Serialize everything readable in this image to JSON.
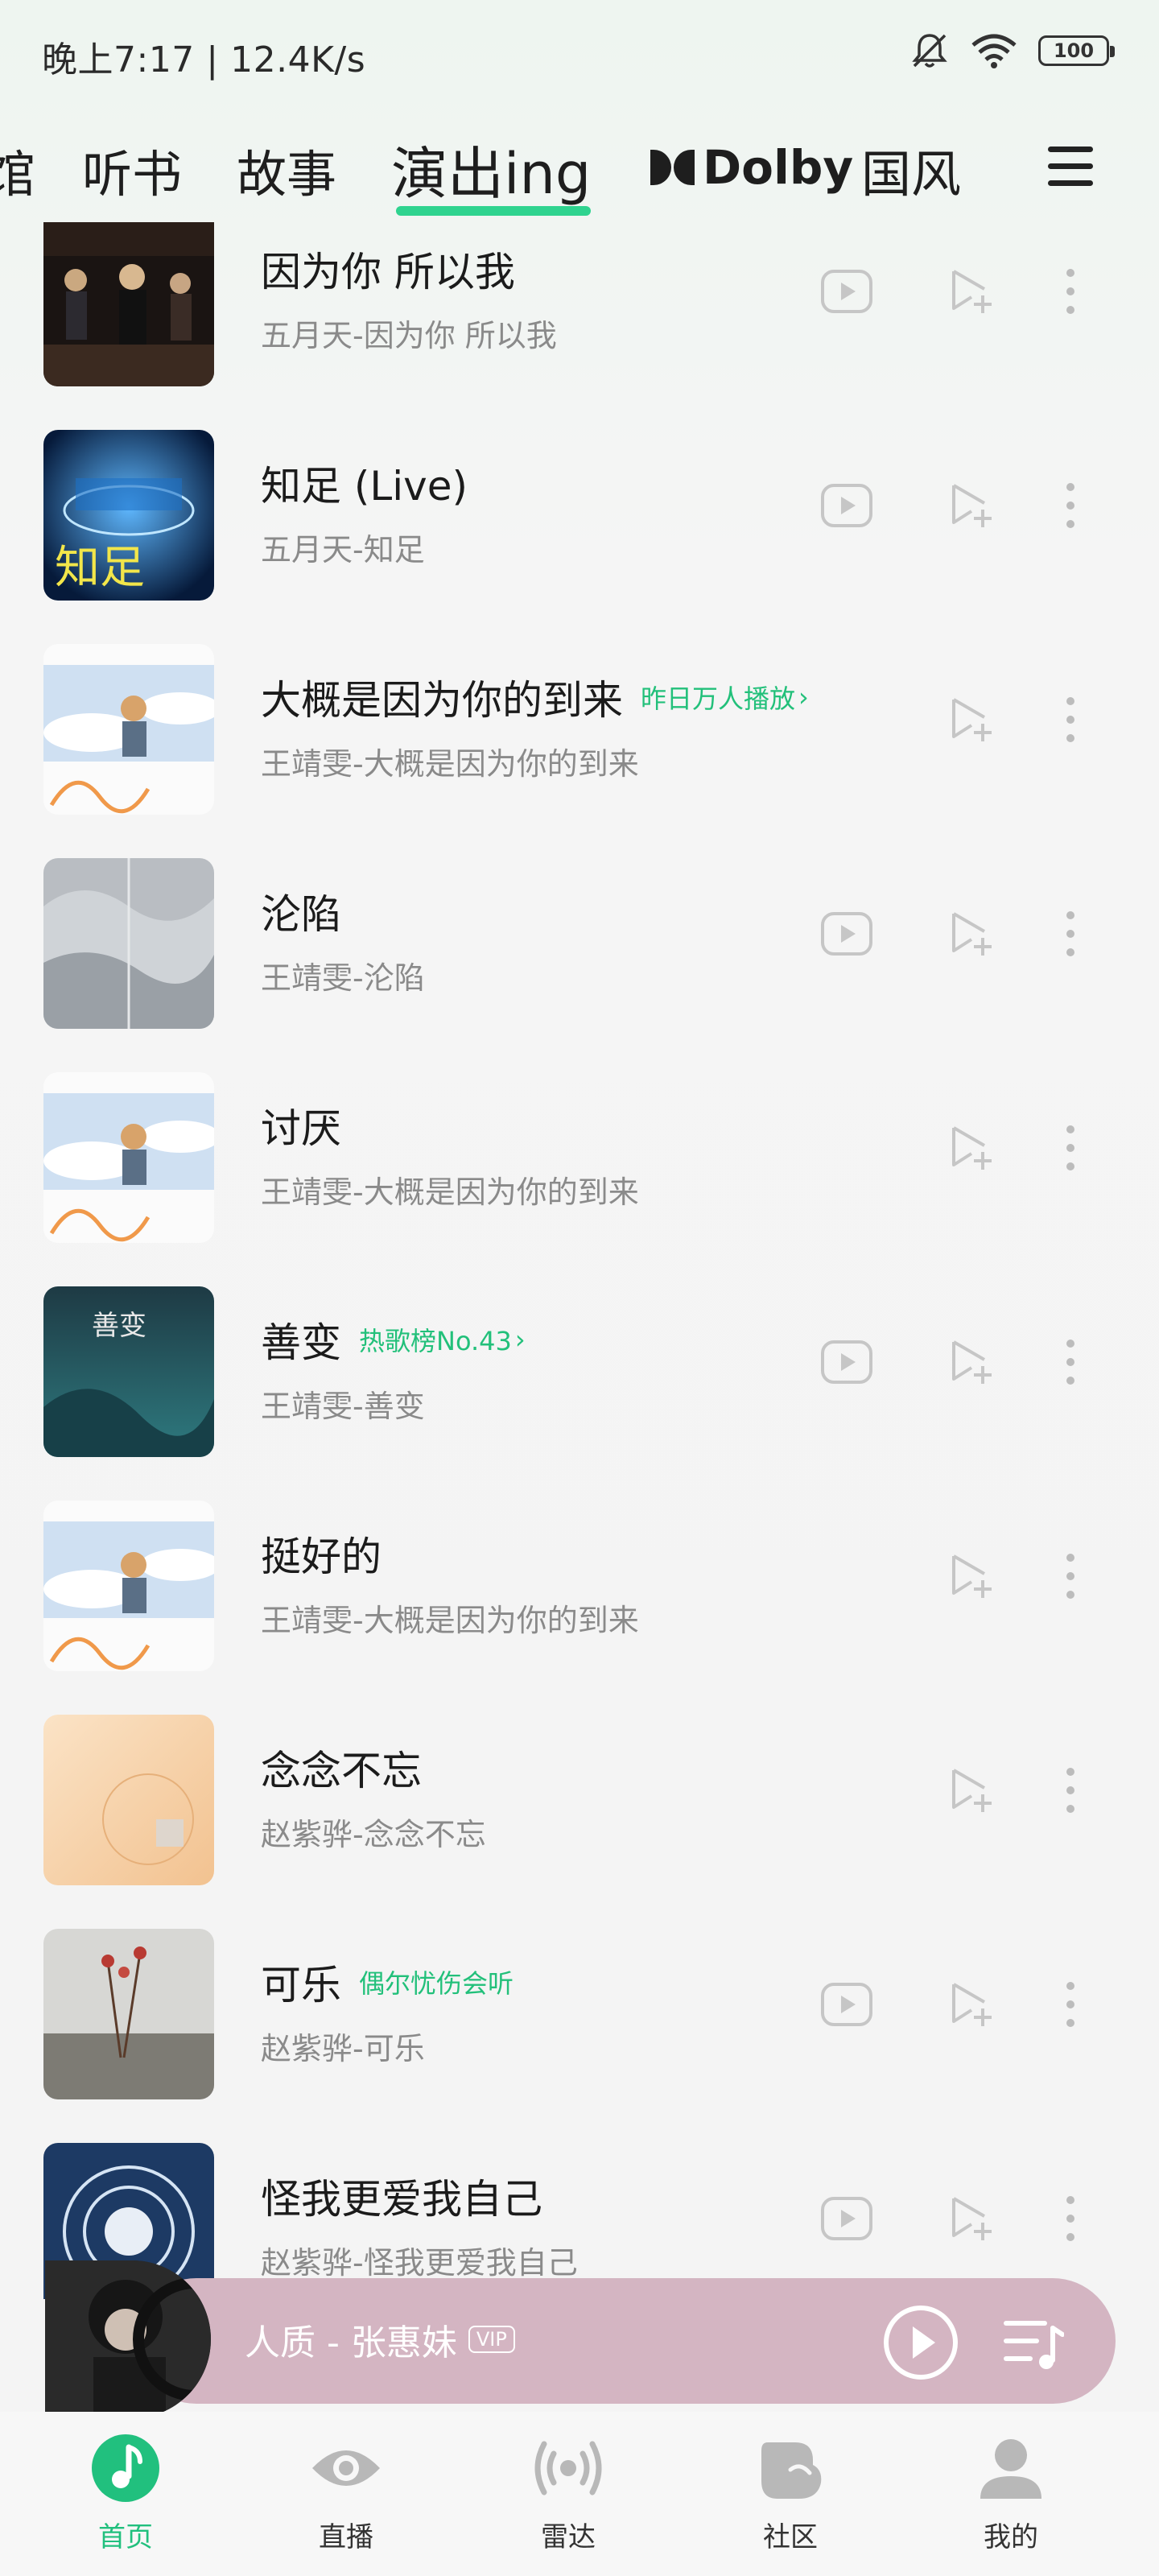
{
  "status_bar": {
    "time_speed": "晚上7:17 | 12.4K/s",
    "battery": "100",
    "icons": [
      "mute-bell-icon",
      "wifi-icon",
      "battery-icon"
    ]
  },
  "top_tabs": {
    "items": [
      {
        "label": "馆"
      },
      {
        "label": "听书"
      },
      {
        "label": "故事"
      },
      {
        "label": "演出ing"
      },
      {
        "label": "Dolby"
      },
      {
        "label": "国风"
      }
    ],
    "active_index": 3,
    "accent": "#2fd38f"
  },
  "songs": [
    {
      "title": "因为你 所以我",
      "tag": "",
      "subtitle": "五月天-因为你 所以我",
      "has_video": true
    },
    {
      "title": "知足 (Live)",
      "tag": "",
      "subtitle": "五月天-知足",
      "has_video": true
    },
    {
      "title": "大概是因为你的到来",
      "tag": "昨日万人播放",
      "subtitle": "王靖雯-大概是因为你的到来",
      "has_video": false
    },
    {
      "title": "沦陷",
      "tag": "",
      "subtitle": "王靖雯-沦陷",
      "has_video": true
    },
    {
      "title": "讨厌",
      "tag": "",
      "subtitle": "王靖雯-大概是因为你的到来",
      "has_video": false
    },
    {
      "title": "善变",
      "tag": "热歌榜No.43",
      "subtitle": "王靖雯-善变",
      "has_video": true
    },
    {
      "title": "挺好的",
      "tag": "",
      "subtitle": "王靖雯-大概是因为你的到来",
      "has_video": false
    },
    {
      "title": "念念不忘",
      "tag": "",
      "subtitle": "赵紫骅-念念不忘",
      "has_video": false
    },
    {
      "title": "可乐",
      "tag": "偶尔忧伤会听",
      "subtitle": "赵紫骅-可乐",
      "has_video": true
    },
    {
      "title": "怪我更爱我自己",
      "tag": "",
      "subtitle": "赵紫骅-怪我更爱我自己",
      "has_video": true
    }
  ],
  "cover_texts": {
    "zhizu": "知足",
    "shanbian": "善变"
  },
  "mini_player": {
    "title": "人质 - 张惠妹",
    "vip": "VIP",
    "background": "#d4b5c2"
  },
  "bottom_nav": {
    "items": [
      {
        "label": "首页",
        "icon": "home-music-icon"
      },
      {
        "label": "直播",
        "icon": "eye-icon"
      },
      {
        "label": "雷达",
        "icon": "radar-icon"
      },
      {
        "label": "社区",
        "icon": "community-icon"
      },
      {
        "label": "我的",
        "icon": "user-icon"
      }
    ],
    "active_index": 0,
    "active_color": "#21c07e"
  }
}
